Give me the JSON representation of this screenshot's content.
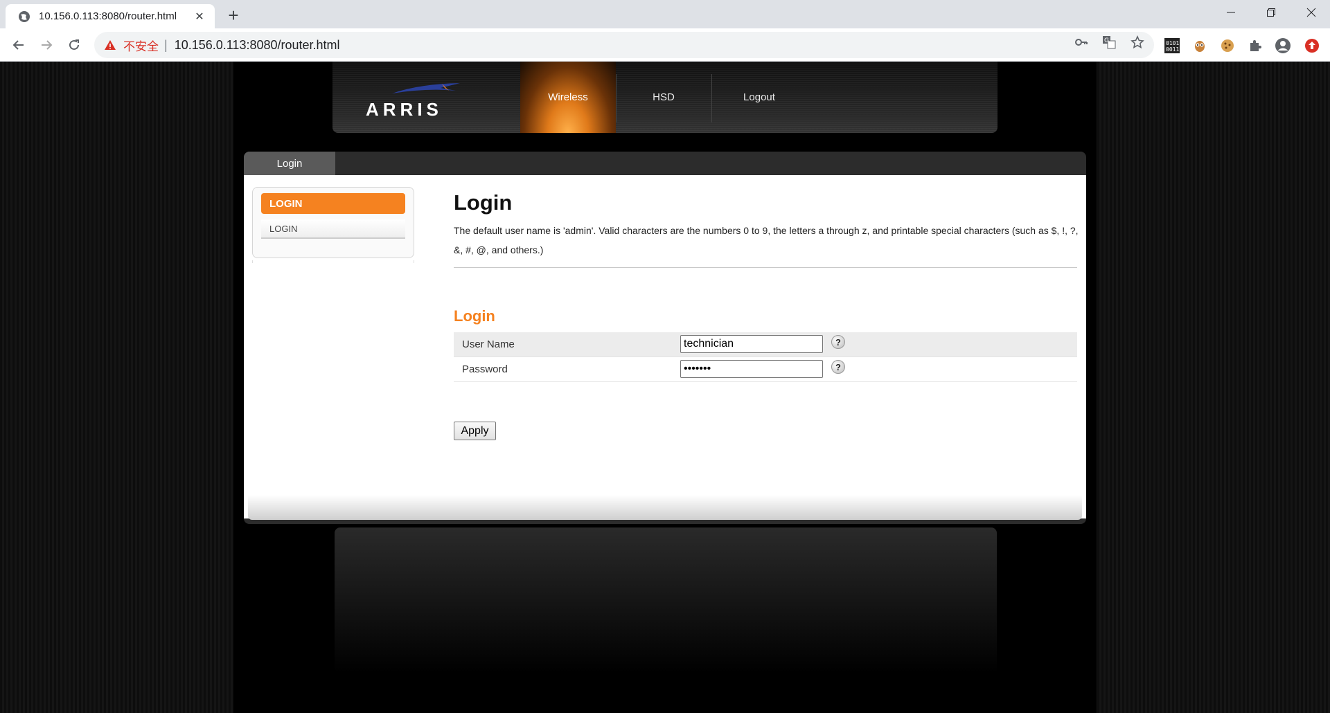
{
  "browser": {
    "tab_title": "10.156.0.113:8080/router.html",
    "insecure_label": "不安全",
    "url": "10.156.0.113:8080/router.html"
  },
  "header": {
    "logo_text": "ARRIS",
    "nav": [
      {
        "label": "Wireless",
        "active": true
      },
      {
        "label": "HSD",
        "active": false
      },
      {
        "label": "Logout",
        "active": false
      }
    ]
  },
  "panel": {
    "tab_label": "Login"
  },
  "sidebar": {
    "heading": "LOGIN",
    "items": [
      "LOGIN"
    ]
  },
  "main": {
    "title": "Login",
    "description": "The default user name is 'admin'. Valid characters are the numbers 0 to 9, the letters a through z, and printable special characters (such as $, !, ?, &, #, @, and others.)",
    "section_title": "Login",
    "fields": [
      {
        "label": "User Name",
        "value": "technician",
        "type": "text",
        "help": "?"
      },
      {
        "label": "Password",
        "value": "•••••••",
        "type": "password",
        "help": "?"
      }
    ],
    "apply_label": "Apply"
  },
  "colors": {
    "accent": "#f58220",
    "insecure": "#d93025"
  }
}
